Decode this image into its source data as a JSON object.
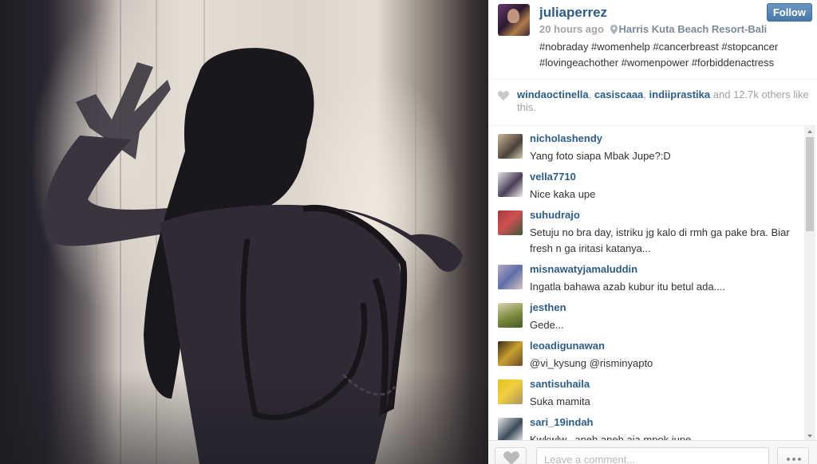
{
  "post": {
    "username": "juliaperrez",
    "follow_label": "Follow",
    "time": "20 hours ago",
    "location": "Harris Kuta Beach Resort-Bali",
    "caption": "#nobraday #womenhelp #cancerbreast #stopcancer #lovingeachother #womenpower #forbiddenactress"
  },
  "likes": {
    "user1": "windaoctinella",
    "sep1": ",",
    "user2": "casiscaaa",
    "sep2": ",",
    "user3": "indiiprastika",
    "and": "and",
    "count": "12.7k",
    "suffix": "others like this."
  },
  "comments": [
    {
      "user": "nicholashendy",
      "text": "Yang foto siapa Mbak Jupe?:D"
    },
    {
      "user": "vella7710",
      "text": "Nice kaka upe"
    },
    {
      "user": "suhudrajo",
      "text": "Setuju no bra day, istriku jg kalo di rmh ga pake bra. Biar fresh n ga iritasi katanya..."
    },
    {
      "user": "misnawatyjamaluddin",
      "text": "Ingatla bahawa azab kubur itu betul ada...."
    },
    {
      "user": "jesthen",
      "text": "Gede..."
    },
    {
      "user": "leoadigunawan",
      "text": "@vi_kysung @risminyapto"
    },
    {
      "user": "santisuhaila",
      "text": "Suka mamita"
    },
    {
      "user": "sari_19indah",
      "text": "Kwkwlw...aneh aneh aja mpok jupe...."
    }
  ],
  "comment_box": {
    "placeholder": "Leave a comment..."
  },
  "icons": {
    "location": "map-pin-icon",
    "likes_heart": "heart-icon",
    "like_button": "heart-icon",
    "more": "more-dots-icon"
  },
  "colors": {
    "link": "#2c5d87",
    "follow_bg": "#4a79a8"
  }
}
